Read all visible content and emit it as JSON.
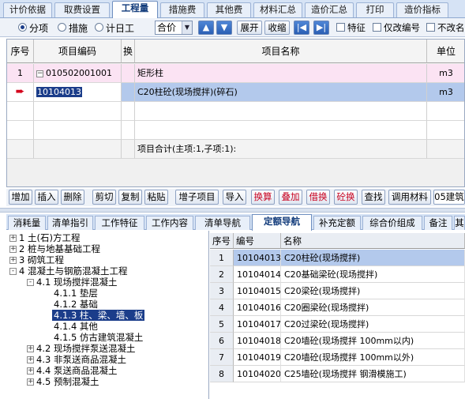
{
  "top_tabs": [
    "计价依据",
    "取费设置",
    "工程量",
    "措施费",
    "其他费",
    "材料汇总",
    "造价汇总",
    "打印",
    "造价指标"
  ],
  "toolbar1": {
    "radio_fenxiang": "分项",
    "radio_cuoshi": "措施",
    "radio_jirigong": "计日工",
    "combo_value": "合价",
    "expand_label": "展开",
    "collapse_label": "收缩",
    "chk_texing": "特征",
    "chk_bianhao": "仅改编号",
    "chk_bugai": "不改名"
  },
  "grid1": {
    "headers": [
      "序号",
      "项目编码",
      "换",
      "项目名称",
      "单位"
    ],
    "rows": [
      {
        "seq": "1",
        "code": "010502001001",
        "name": "矩形柱",
        "unit": "m3"
      },
      {
        "seq": "",
        "code": "10104013",
        "name": "C20柱砼(现场搅拌)(碎石)",
        "unit": "m3"
      }
    ],
    "summary": "项目合计(主项:1,子项:1):"
  },
  "toolbar2": [
    "增加",
    "插入",
    "删除",
    "剪切",
    "复制",
    "粘贴",
    "增子项目",
    "导入",
    "换算",
    "叠加",
    "借换",
    "砼换",
    "查找",
    "调用材料",
    "05建筑"
  ],
  "bottom_tabs": [
    "消耗量",
    "清单指引",
    "工作特征",
    "工作内容",
    "清单导航",
    "定额导航",
    "补充定额",
    "综合价组成",
    "备注",
    "其"
  ],
  "tree": [
    {
      "label": "1 土(石)方工程",
      "box": "+"
    },
    {
      "label": "2 桩与地基基础工程",
      "box": "+"
    },
    {
      "label": "3 砌筑工程",
      "box": "+"
    },
    {
      "label": "4 混凝土与钢筋混凝土工程",
      "box": "-"
    },
    {
      "label": "4.1 现场搅拌混凝土",
      "box": "-"
    },
    {
      "label": "4.1.1 垫层",
      "box": ""
    },
    {
      "label": "4.1.2 基础",
      "box": ""
    },
    {
      "label": "4.1.3 柱、梁、墙、板",
      "box": ""
    },
    {
      "label": "4.1.4 其他",
      "box": ""
    },
    {
      "label": "4.1.5 仿古建筑混凝土",
      "box": ""
    },
    {
      "label": "4.2 现场搅拌泵送混凝土",
      "box": "+"
    },
    {
      "label": "4.3 非泵送商品混凝土",
      "box": "+"
    },
    {
      "label": "4.4 泵送商品混凝土",
      "box": "+"
    },
    {
      "label": "4.5 预制混凝土",
      "box": "+"
    }
  ],
  "grid2": {
    "headers": [
      "序号",
      "编号",
      "名称"
    ],
    "rows": [
      {
        "n": "1",
        "code": "10104013",
        "name": "C20柱砼(现场搅拌)"
      },
      {
        "n": "2",
        "code": "10104014",
        "name": "C20基础梁砼(现场搅拌)"
      },
      {
        "n": "3",
        "code": "10104015",
        "name": "C20梁砼(现场搅拌)"
      },
      {
        "n": "4",
        "code": "10104016",
        "name": "C20圈梁砼(现场搅拌)"
      },
      {
        "n": "5",
        "code": "10104017",
        "name": "C20过梁砼(现场搅拌)"
      },
      {
        "n": "6",
        "code": "10104018",
        "name": "C20墙砼(现场搅拌 100mm以内)"
      },
      {
        "n": "7",
        "code": "10104019",
        "name": "C20墙砼(现场搅拌 100mm以外)"
      },
      {
        "n": "8",
        "code": "10104020",
        "name": "C25墙砼(现场搅拌 钢滑模施工)"
      }
    ]
  }
}
